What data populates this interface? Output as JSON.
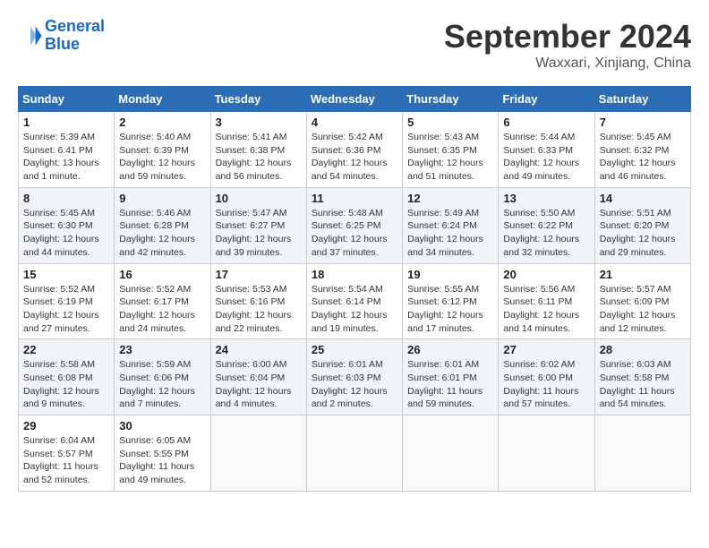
{
  "header": {
    "logo_line1": "General",
    "logo_line2": "Blue",
    "month": "September 2024",
    "location": "Waxxari, Xinjiang, China"
  },
  "days_of_week": [
    "Sunday",
    "Monday",
    "Tuesday",
    "Wednesday",
    "Thursday",
    "Friday",
    "Saturday"
  ],
  "weeks": [
    [
      {
        "day": "1",
        "info": "Sunrise: 5:39 AM\nSunset: 6:41 PM\nDaylight: 13 hours\nand 1 minute."
      },
      {
        "day": "2",
        "info": "Sunrise: 5:40 AM\nSunset: 6:39 PM\nDaylight: 12 hours\nand 59 minutes."
      },
      {
        "day": "3",
        "info": "Sunrise: 5:41 AM\nSunset: 6:38 PM\nDaylight: 12 hours\nand 56 minutes."
      },
      {
        "day": "4",
        "info": "Sunrise: 5:42 AM\nSunset: 6:36 PM\nDaylight: 12 hours\nand 54 minutes."
      },
      {
        "day": "5",
        "info": "Sunrise: 5:43 AM\nSunset: 6:35 PM\nDaylight: 12 hours\nand 51 minutes."
      },
      {
        "day": "6",
        "info": "Sunrise: 5:44 AM\nSunset: 6:33 PM\nDaylight: 12 hours\nand 49 minutes."
      },
      {
        "day": "7",
        "info": "Sunrise: 5:45 AM\nSunset: 6:32 PM\nDaylight: 12 hours\nand 46 minutes."
      }
    ],
    [
      {
        "day": "8",
        "info": "Sunrise: 5:45 AM\nSunset: 6:30 PM\nDaylight: 12 hours\nand 44 minutes."
      },
      {
        "day": "9",
        "info": "Sunrise: 5:46 AM\nSunset: 6:28 PM\nDaylight: 12 hours\nand 42 minutes."
      },
      {
        "day": "10",
        "info": "Sunrise: 5:47 AM\nSunset: 6:27 PM\nDaylight: 12 hours\nand 39 minutes."
      },
      {
        "day": "11",
        "info": "Sunrise: 5:48 AM\nSunset: 6:25 PM\nDaylight: 12 hours\nand 37 minutes."
      },
      {
        "day": "12",
        "info": "Sunrise: 5:49 AM\nSunset: 6:24 PM\nDaylight: 12 hours\nand 34 minutes."
      },
      {
        "day": "13",
        "info": "Sunrise: 5:50 AM\nSunset: 6:22 PM\nDaylight: 12 hours\nand 32 minutes."
      },
      {
        "day": "14",
        "info": "Sunrise: 5:51 AM\nSunset: 6:20 PM\nDaylight: 12 hours\nand 29 minutes."
      }
    ],
    [
      {
        "day": "15",
        "info": "Sunrise: 5:52 AM\nSunset: 6:19 PM\nDaylight: 12 hours\nand 27 minutes."
      },
      {
        "day": "16",
        "info": "Sunrise: 5:52 AM\nSunset: 6:17 PM\nDaylight: 12 hours\nand 24 minutes."
      },
      {
        "day": "17",
        "info": "Sunrise: 5:53 AM\nSunset: 6:16 PM\nDaylight: 12 hours\nand 22 minutes."
      },
      {
        "day": "18",
        "info": "Sunrise: 5:54 AM\nSunset: 6:14 PM\nDaylight: 12 hours\nand 19 minutes."
      },
      {
        "day": "19",
        "info": "Sunrise: 5:55 AM\nSunset: 6:12 PM\nDaylight: 12 hours\nand 17 minutes."
      },
      {
        "day": "20",
        "info": "Sunrise: 5:56 AM\nSunset: 6:11 PM\nDaylight: 12 hours\nand 14 minutes."
      },
      {
        "day": "21",
        "info": "Sunrise: 5:57 AM\nSunset: 6:09 PM\nDaylight: 12 hours\nand 12 minutes."
      }
    ],
    [
      {
        "day": "22",
        "info": "Sunrise: 5:58 AM\nSunset: 6:08 PM\nDaylight: 12 hours\nand 9 minutes."
      },
      {
        "day": "23",
        "info": "Sunrise: 5:59 AM\nSunset: 6:06 PM\nDaylight: 12 hours\nand 7 minutes."
      },
      {
        "day": "24",
        "info": "Sunrise: 6:00 AM\nSunset: 6:04 PM\nDaylight: 12 hours\nand 4 minutes."
      },
      {
        "day": "25",
        "info": "Sunrise: 6:01 AM\nSunset: 6:03 PM\nDaylight: 12 hours\nand 2 minutes."
      },
      {
        "day": "26",
        "info": "Sunrise: 6:01 AM\nSunset: 6:01 PM\nDaylight: 11 hours\nand 59 minutes."
      },
      {
        "day": "27",
        "info": "Sunrise: 6:02 AM\nSunset: 6:00 PM\nDaylight: 11 hours\nand 57 minutes."
      },
      {
        "day": "28",
        "info": "Sunrise: 6:03 AM\nSunset: 5:58 PM\nDaylight: 11 hours\nand 54 minutes."
      }
    ],
    [
      {
        "day": "29",
        "info": "Sunrise: 6:04 AM\nSunset: 5:57 PM\nDaylight: 11 hours\nand 52 minutes."
      },
      {
        "day": "30",
        "info": "Sunrise: 6:05 AM\nSunset: 5:55 PM\nDaylight: 11 hours\nand 49 minutes."
      },
      null,
      null,
      null,
      null,
      null
    ]
  ]
}
